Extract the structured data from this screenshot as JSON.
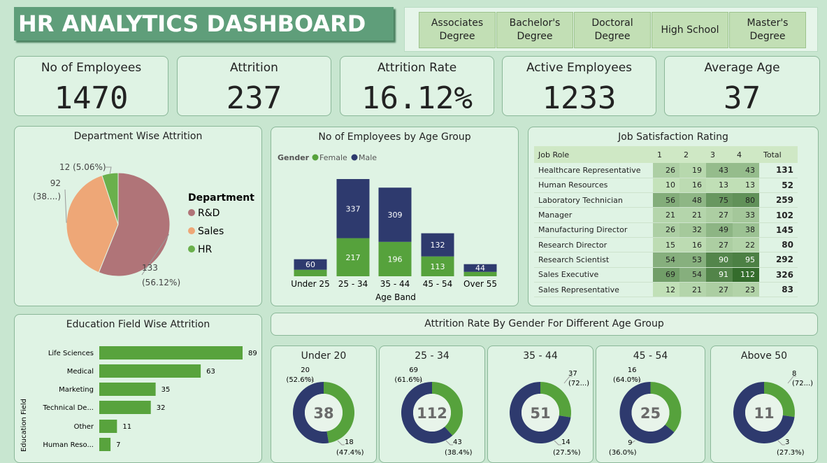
{
  "title": "HR ANALYTICS DASHBOARD",
  "education_slicer": [
    "Associates\nDegree",
    "Bachelor's\nDegree",
    "Doctoral\nDegree",
    "High School",
    "Master's\nDegree"
  ],
  "kpis": [
    {
      "label": "No of Employees",
      "value": "1470"
    },
    {
      "label": "Attrition",
      "value": "237"
    },
    {
      "label": "Attrition Rate",
      "value": "16.12%"
    },
    {
      "label": "Active Employees",
      "value": "1233"
    },
    {
      "label": "Average Age",
      "value": "37"
    }
  ],
  "colors": {
    "rd": "#b07478",
    "sales": "#eea777",
    "hr": "#6ab04c",
    "female": "#56a23c",
    "male": "#2e3a6e",
    "bar": "#58a33d"
  },
  "chart_data": [
    {
      "type": "pie",
      "title": "Department Wise Attrition",
      "legend_title": "Department",
      "legend_position": "right",
      "slices": [
        {
          "name": "R&D",
          "value": 133,
          "label1": "133",
          "label2": "(56.12%)"
        },
        {
          "name": "Sales",
          "value": 92,
          "label1": "92",
          "label2": "(38....)"
        },
        {
          "name": "HR",
          "value": 12,
          "label1": "12 (5.06%)",
          "label2": ""
        }
      ]
    },
    {
      "type": "bar",
      "stacked": true,
      "title": "No of Employees by Age Group",
      "legend_title": "Gender",
      "xlabel": "Age Band",
      "categories": [
        "Under 25",
        "25 - 34",
        "35 - 44",
        "45 - 54",
        "Over 55"
      ],
      "series": [
        {
          "name": "Female",
          "values": [
            37,
            217,
            196,
            113,
            25
          ]
        },
        {
          "name": "Male",
          "values": [
            60,
            337,
            309,
            132,
            44
          ]
        }
      ],
      "data_labels": {
        "Female": [
          "",
          "217",
          "196",
          "113",
          ""
        ],
        "Male": [
          "60",
          "337",
          "309",
          "132",
          "44"
        ]
      }
    },
    {
      "type": "table",
      "title": "Job Satisfaction Rating",
      "columns": [
        "Job Role",
        "1",
        "2",
        "3",
        "4",
        "Total"
      ],
      "rows": [
        [
          "Healthcare Representative",
          26,
          19,
          43,
          43,
          131
        ],
        [
          "Human Resources",
          10,
          16,
          13,
          13,
          52
        ],
        [
          "Laboratory Technician",
          56,
          48,
          75,
          80,
          259
        ],
        [
          "Manager",
          21,
          21,
          27,
          33,
          102
        ],
        [
          "Manufacturing Director",
          26,
          32,
          49,
          38,
          145
        ],
        [
          "Research Director",
          15,
          16,
          27,
          22,
          80
        ],
        [
          "Research Scientist",
          54,
          53,
          90,
          95,
          292
        ],
        [
          "Sales Executive",
          69,
          54,
          91,
          112,
          326
        ],
        [
          "Sales Representative",
          12,
          21,
          27,
          23,
          83
        ]
      ]
    },
    {
      "type": "bar",
      "orientation": "horizontal",
      "title": "Education Field Wise Attrition",
      "ylabel": "Education Field",
      "categories": [
        "Life Sciences",
        "Medical",
        "Marketing",
        "Technical De...",
        "Other",
        "Human Reso..."
      ],
      "values": [
        89,
        63,
        35,
        32,
        11,
        7
      ]
    },
    {
      "type": "pie",
      "title": "Attrition Rate By Gender For Different Age Group",
      "donuts": [
        {
          "title": "Under 20",
          "total": "38",
          "male": 20,
          "female": 18,
          "male_l1": "20",
          "male_l2": "(52.6%)",
          "female_l1": "18",
          "female_l2": "(47.4%)"
        },
        {
          "title": "25 - 34",
          "total": "112",
          "male": 69,
          "female": 43,
          "male_l1": "69",
          "male_l2": "(61.6%)",
          "female_l1": "43",
          "female_l2": "(38.4%)"
        },
        {
          "title": "35 - 44",
          "total": "51",
          "male": 37,
          "female": 14,
          "male_l1": "37",
          "male_l2": "(72...)",
          "female_l1": "14",
          "female_l2": "(27.5%)"
        },
        {
          "title": "45 - 54",
          "total": "25",
          "male": 16,
          "female": 9,
          "male_l1": "16",
          "male_l2": "(64.0%)",
          "female_l1": "9",
          "female_l2": "(36.0%)"
        },
        {
          "title": "Above 50",
          "total": "11",
          "male": 8,
          "female": 3,
          "male_l1": "8",
          "male_l2": "(72...)",
          "female_l1": "3",
          "female_l2": "(27.3%)"
        }
      ]
    }
  ]
}
